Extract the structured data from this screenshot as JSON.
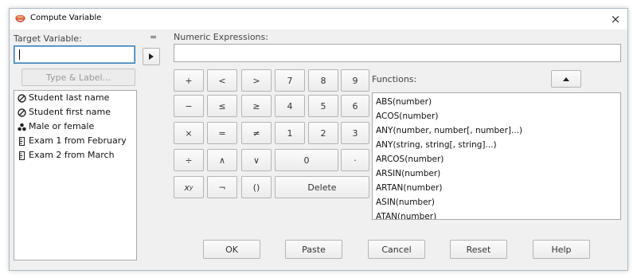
{
  "window": {
    "title": "Compute Variable",
    "close_symbol": "×"
  },
  "target": {
    "label": "Target Variable:",
    "value": "",
    "type_label_button": "Type & Label..."
  },
  "equals_sign": "=",
  "expression": {
    "label": "Numeric Expressions:",
    "value": ""
  },
  "variables": [
    {
      "name": "Student last name",
      "type": "nominal-string"
    },
    {
      "name": "Student first name",
      "type": "nominal-string"
    },
    {
      "name": "Male or female",
      "type": "nominal"
    },
    {
      "name": "Exam 1 from February",
      "type": "scale"
    },
    {
      "name": "Exam 2 from March",
      "type": "scale"
    }
  ],
  "keypad": {
    "row1": [
      "+",
      "<",
      ">",
      "7",
      "8",
      "9"
    ],
    "row2": [
      "−",
      "≤",
      "≥",
      "4",
      "5",
      "6"
    ],
    "row3": [
      "×",
      "=",
      "≠",
      "1",
      "2",
      "3"
    ],
    "row4": [
      "÷",
      "∧",
      "∨",
      "0",
      "·"
    ],
    "row5_power": "x",
    "row5_power_sup": "y",
    "row5_not": "¬",
    "row5_parens": "()",
    "row5_delete": "Delete"
  },
  "functions": {
    "label": "Functions:",
    "items": [
      "ABS(number)",
      "ACOS(number)",
      "ANY(number, number[, number]...)",
      "ANY(string, string[, string]...)",
      "ARCOS(number)",
      "ARSIN(number)",
      "ARTAN(number)",
      "ASIN(number)",
      "ATAN(number)"
    ]
  },
  "footer": {
    "ok": "OK",
    "paste": "Paste",
    "cancel": "Cancel",
    "reset": "Reset",
    "help": "Help"
  },
  "colors": {
    "accent": "#3c7fb1",
    "title_icon": "#d9462b"
  }
}
